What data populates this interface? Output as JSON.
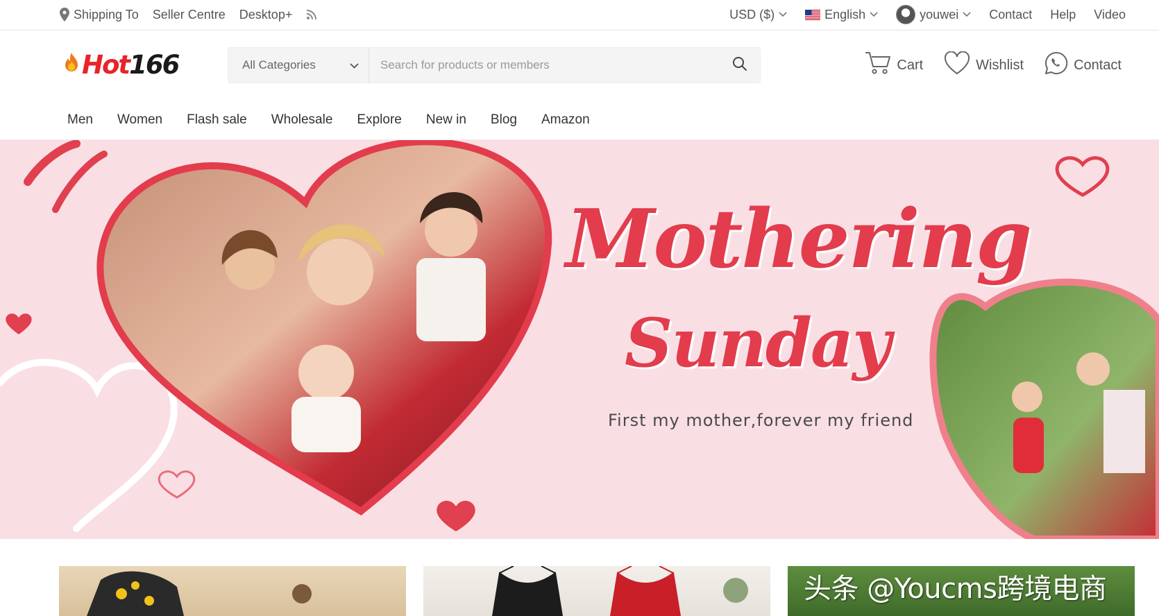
{
  "topbar": {
    "shipping_label": "Shipping To",
    "seller_centre": "Seller Centre",
    "desktop_plus": "Desktop+",
    "currency": "USD ($)",
    "language": "English",
    "username": "youwei",
    "contact": "Contact",
    "help": "Help",
    "video": "Video"
  },
  "header": {
    "logo_hot": "Hot",
    "logo_num": "166",
    "search": {
      "category": "All Categories",
      "placeholder": "Search for products or members"
    },
    "actions": {
      "cart": "Cart",
      "wishlist": "Wishlist",
      "contact": "Contact"
    }
  },
  "nav": {
    "items": [
      "Men",
      "Women",
      "Flash sale",
      "Wholesale",
      "Explore",
      "New in",
      "Blog",
      "Amazon"
    ]
  },
  "banner": {
    "title_line1": "Mothering",
    "title_line2": "Sunday",
    "subtitle": "First my mother,forever my friend"
  },
  "watermark": "头条 @Youcms跨境电商",
  "colors": {
    "brand_red": "#e8232a",
    "banner_bg": "#f9dfe4",
    "banner_title": "#e23c4d"
  },
  "icons": [
    "location-pin-icon",
    "rss-icon",
    "chevron-down-icon",
    "us-flag-icon",
    "search-icon",
    "cart-icon",
    "heart-icon",
    "whatsapp-icon"
  ]
}
